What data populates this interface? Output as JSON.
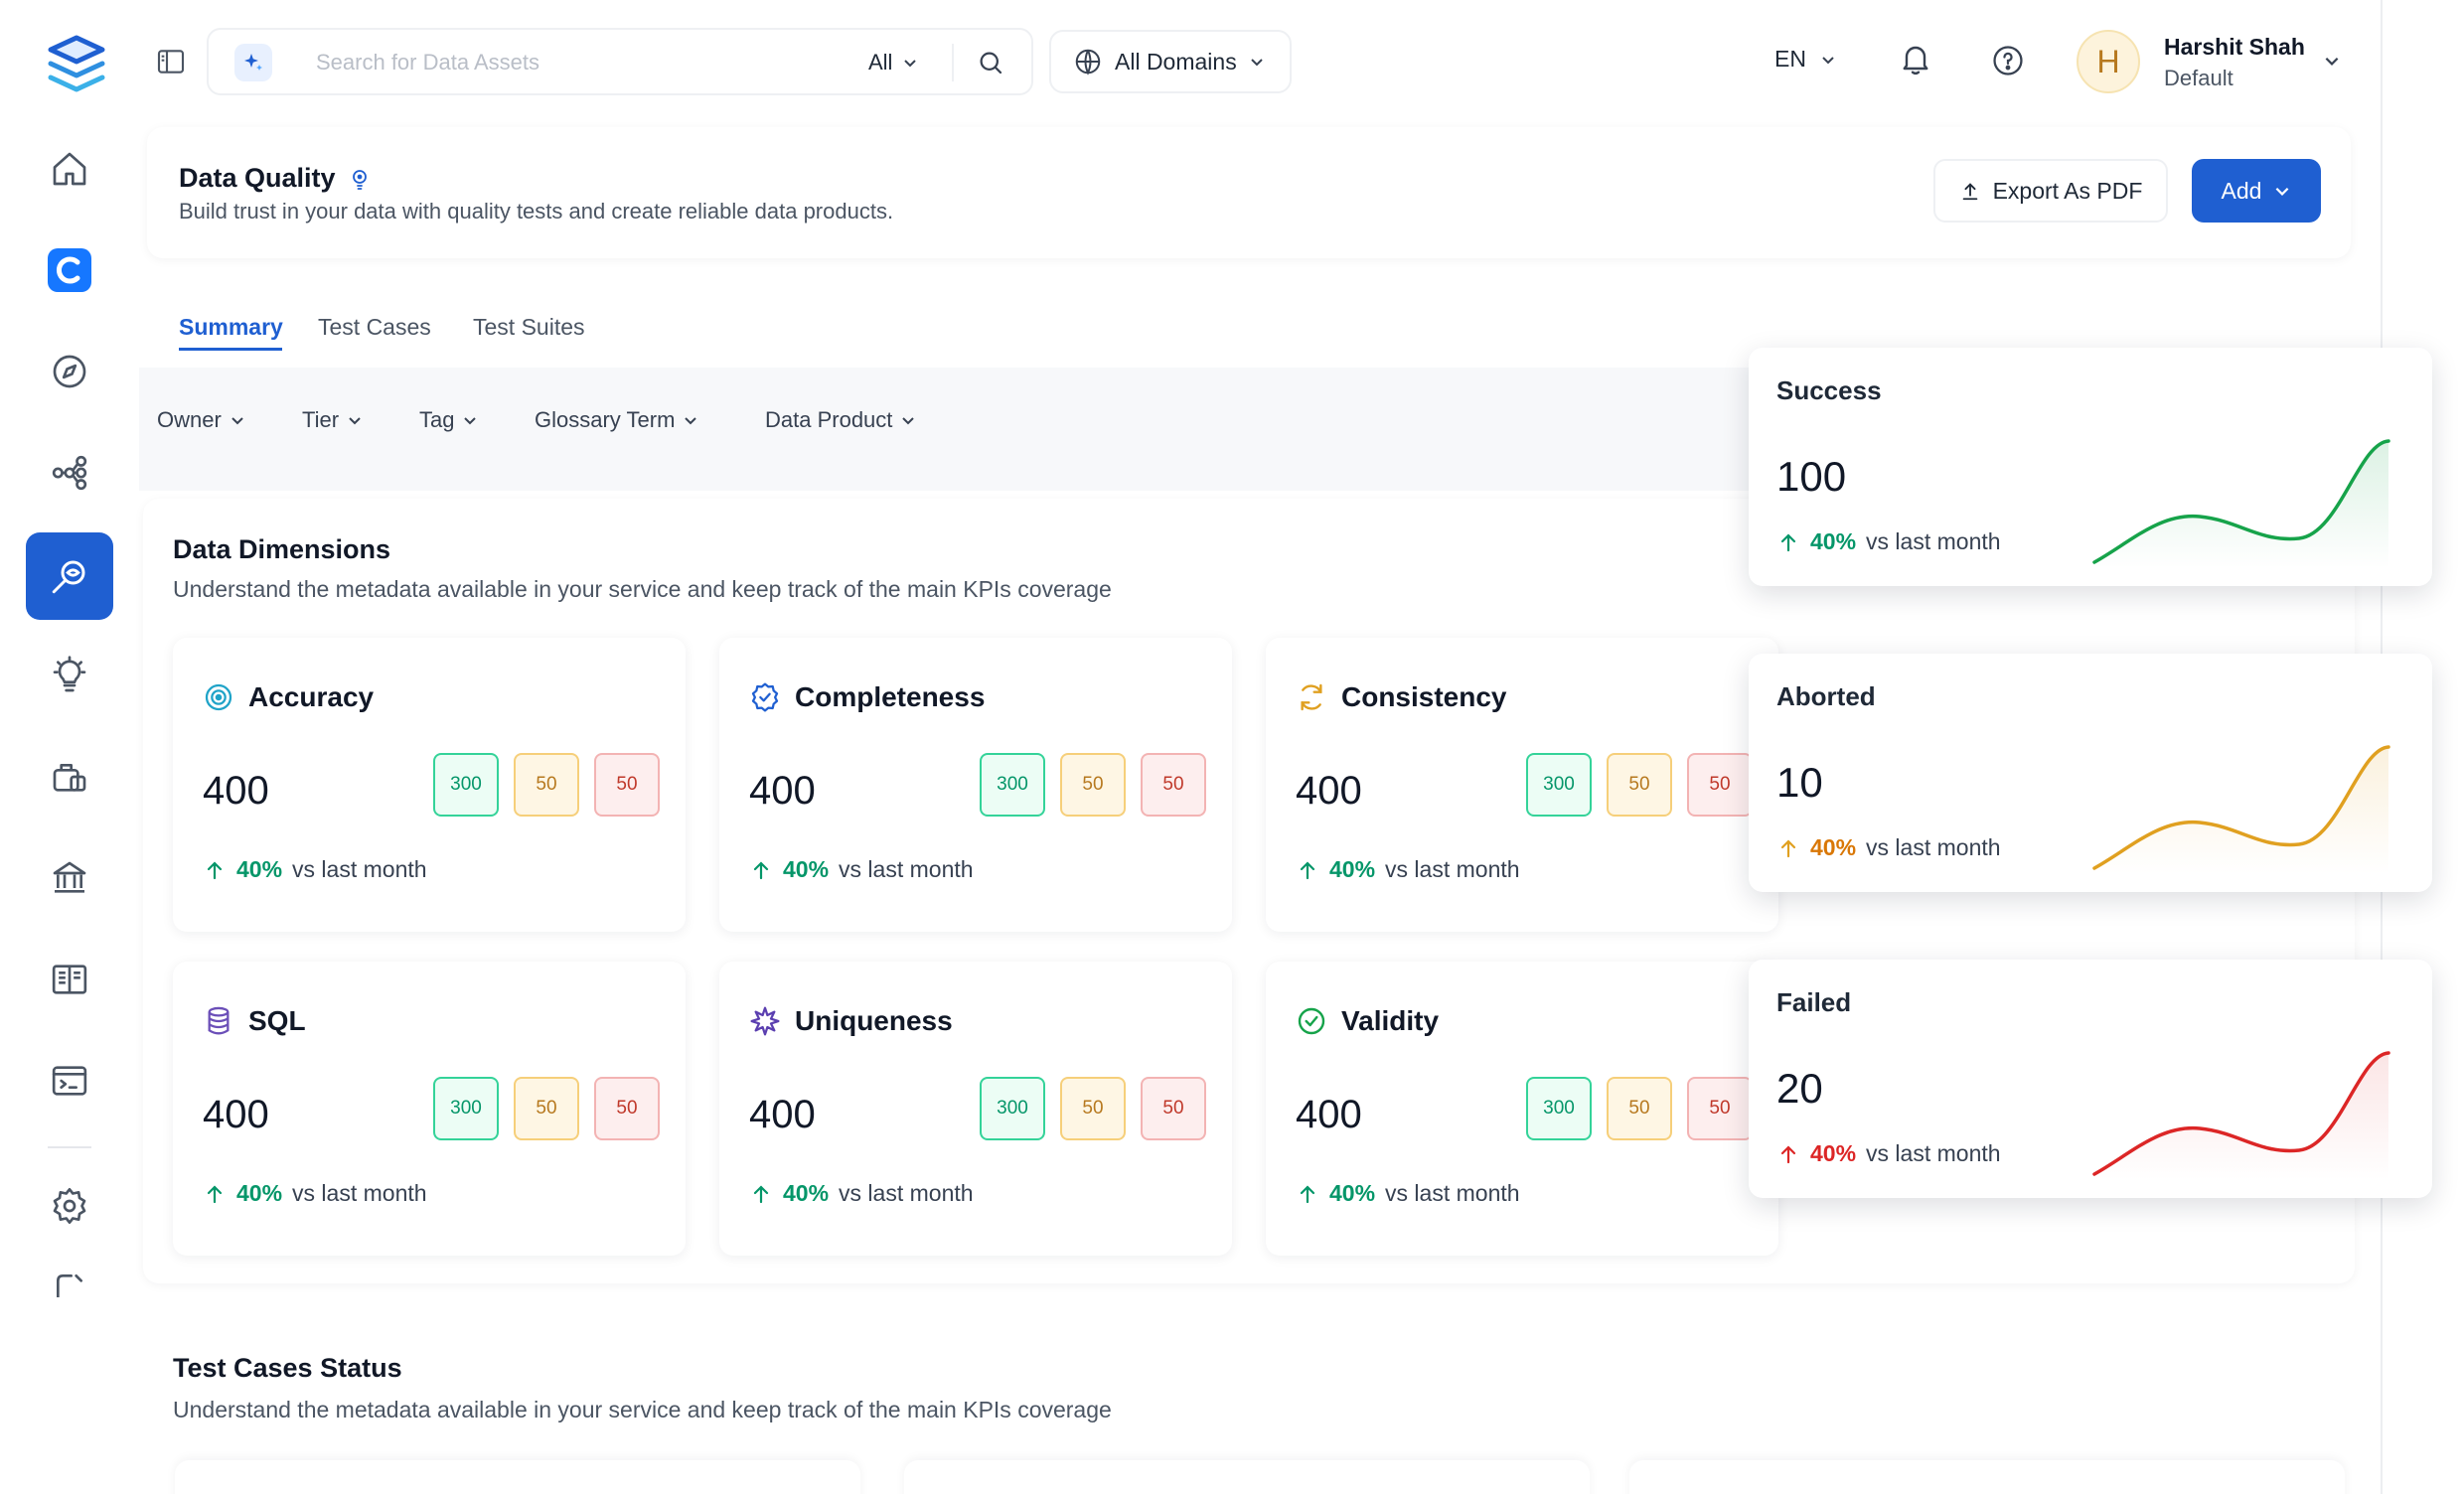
{
  "search": {
    "placeholder": "Search for Data Assets",
    "filter_label": "All"
  },
  "domain": {
    "label": "All Domains"
  },
  "language": {
    "label": "EN"
  },
  "user": {
    "initial": "H",
    "name": "Harshit Shah",
    "role": "Default"
  },
  "page": {
    "title": "Data Quality",
    "subtitle": "Build trust in your data with quality tests and create reliable data products.",
    "export_label": "Export As PDF",
    "add_label": "Add"
  },
  "tabs": [
    {
      "label": "Summary",
      "active": true
    },
    {
      "label": "Test Cases",
      "active": false
    },
    {
      "label": "Test Suites",
      "active": false
    }
  ],
  "filters": [
    "Owner",
    "Tier",
    "Tag",
    "Glossary Term",
    "Data Product"
  ],
  "data_dimensions": {
    "title": "Data Dimensions",
    "subtitle": "Understand the metadata available in your service and keep track of the main KPIs coverage",
    "cards": [
      {
        "name": "Accuracy",
        "icon": "target-icon",
        "value": "400",
        "success": "300",
        "aborted": "50",
        "failed": "50",
        "pct": "40%",
        "trend": "vs last month"
      },
      {
        "name": "Completeness",
        "icon": "check-badge-icon",
        "value": "400",
        "success": "300",
        "aborted": "50",
        "failed": "50",
        "pct": "40%",
        "trend": "vs last month"
      },
      {
        "name": "Consistency",
        "icon": "refresh-icon",
        "value": "400",
        "success": "300",
        "aborted": "50",
        "failed": "50",
        "pct": "40%",
        "trend": "vs last month"
      },
      {
        "name": "SQL",
        "icon": "database-icon",
        "value": "400",
        "success": "300",
        "aborted": "50",
        "failed": "50",
        "pct": "40%",
        "trend": "vs last month"
      },
      {
        "name": "Uniqueness",
        "icon": "sparkle-icon",
        "value": "400",
        "success": "300",
        "aborted": "50",
        "failed": "50",
        "pct": "40%",
        "trend": "vs last month"
      },
      {
        "name": "Validity",
        "icon": "check-circle-icon",
        "value": "400",
        "success": "300",
        "aborted": "50",
        "failed": "50",
        "pct": "40%",
        "trend": "vs last month"
      }
    ]
  },
  "test_cases_status": {
    "title": "Test Cases Status",
    "subtitle": "Understand the metadata available in your service and keep track of the main KPIs coverage"
  },
  "kpis": [
    {
      "title": "Success",
      "value": "100",
      "pct": "40%",
      "trend": "vs last month",
      "color": "#16a34a"
    },
    {
      "title": "Aborted",
      "value": "10",
      "pct": "40%",
      "trend": "vs last month",
      "color": "#e0a020"
    },
    {
      "title": "Failed",
      "value": "20",
      "pct": "40%",
      "trend": "vs last month",
      "color": "#dc2626"
    }
  ],
  "colors": {
    "accent": "#1f5fd1",
    "success": "#059669",
    "warning": "#d97706",
    "danger": "#dc2626"
  }
}
